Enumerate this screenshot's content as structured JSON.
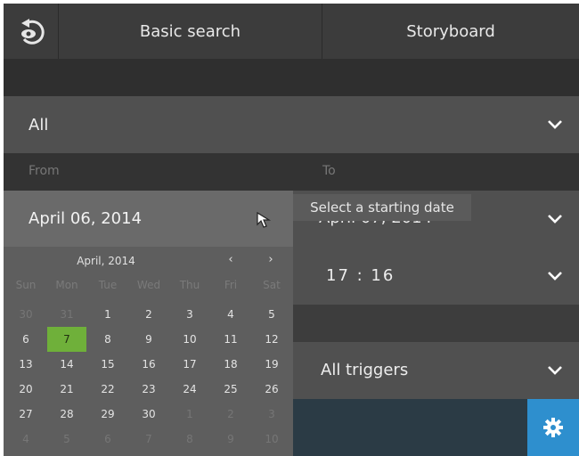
{
  "header": {
    "back_icon": "eye-back-icon",
    "tabs": [
      {
        "label": "Basic search"
      },
      {
        "label": "Storyboard"
      }
    ]
  },
  "filter": {
    "value": "All"
  },
  "range": {
    "from_label": "From",
    "to_label": "To",
    "from_date": "April 06, 2014",
    "to_date": "April 07, 2014"
  },
  "tooltip": {
    "text": "Select a starting date"
  },
  "time": {
    "value": "17 : 16"
  },
  "triggers": {
    "value": "All triggers"
  },
  "calendar": {
    "month_label": "April, 2014",
    "prev": "‹",
    "next": "›",
    "weekdays": [
      "Sun",
      "Mon",
      "Tue",
      "Wed",
      "Thu",
      "Fri",
      "Sat"
    ],
    "selected": "7",
    "weeks": [
      [
        "30",
        "31",
        "1",
        "2",
        "3",
        "4",
        "5"
      ],
      [
        "6",
        "7",
        "8",
        "9",
        "10",
        "11",
        "12"
      ],
      [
        "13",
        "14",
        "15",
        "16",
        "17",
        "18",
        "19"
      ],
      [
        "20",
        "21",
        "22",
        "23",
        "24",
        "25",
        "26"
      ],
      [
        "27",
        "28",
        "29",
        "30",
        "1",
        "2",
        "3"
      ],
      [
        "4",
        "5",
        "6",
        "7",
        "8",
        "9",
        "10"
      ]
    ],
    "muted_pattern": [
      [
        1,
        1,
        0,
        0,
        0,
        0,
        0
      ],
      [
        0,
        0,
        0,
        0,
        0,
        0,
        0
      ],
      [
        0,
        0,
        0,
        0,
        0,
        0,
        0
      ],
      [
        0,
        0,
        0,
        0,
        0,
        0,
        0
      ],
      [
        0,
        0,
        0,
        0,
        1,
        1,
        1
      ],
      [
        1,
        1,
        1,
        1,
        1,
        1,
        1
      ]
    ]
  },
  "colors": {
    "accent": "#2e8fce",
    "selected_day": "#6fb03a"
  }
}
